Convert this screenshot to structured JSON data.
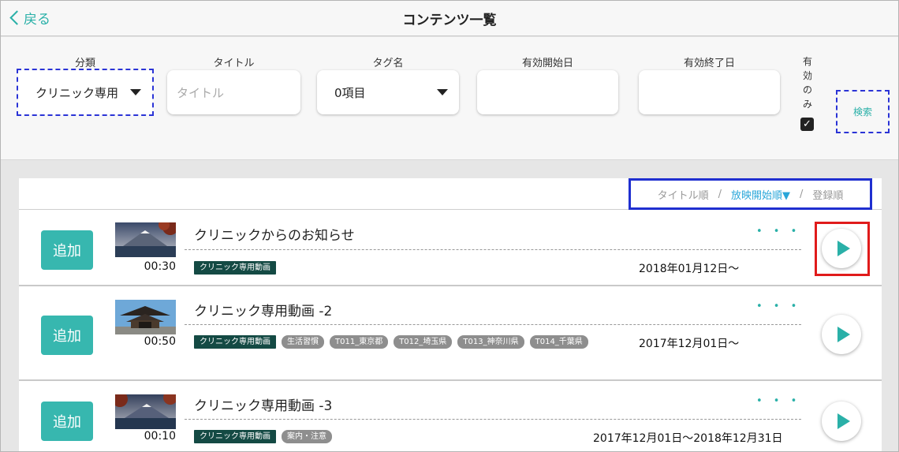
{
  "header": {
    "back_label": "戻る",
    "title": "コンテンツ一覧"
  },
  "filters": {
    "category": {
      "label": "分類",
      "value": "クリニック専用"
    },
    "title": {
      "label": "タイトル",
      "placeholder": "タイトル"
    },
    "tag": {
      "label": "タグ名",
      "value": "0項目"
    },
    "start_date": {
      "label": "有効開始日",
      "value": ""
    },
    "end_date": {
      "label": "有効終了日",
      "value": ""
    },
    "valid_only": {
      "label_chars": [
        "有",
        "効",
        "の",
        "み"
      ],
      "checked": true,
      "check_mark": "✓"
    },
    "search_label": "検索"
  },
  "sort": {
    "title_order": "タイトル順",
    "separator": "/",
    "start_order": "放映開始順▼",
    "register_order": "登録順"
  },
  "items": [
    {
      "add_label": "追加",
      "duration": "00:30",
      "title": "クリニックからのお知らせ",
      "more": "• • •",
      "tags": [
        {
          "text": "クリニック専用動画",
          "style": "primary"
        }
      ],
      "date": "2018年01月12日〜"
    },
    {
      "add_label": "追加",
      "duration": "00:50",
      "title": "クリニック専用動画 -2",
      "more": "• • •",
      "tags": [
        {
          "text": "クリニック専用動画",
          "style": "primary"
        },
        {
          "text": "生活習慣",
          "style": "gray"
        },
        {
          "text": "T011_東京都",
          "style": "gray"
        },
        {
          "text": "T012_埼玉県",
          "style": "gray"
        },
        {
          "text": "T013_神奈川県",
          "style": "gray"
        },
        {
          "text": "T014_千葉県",
          "style": "gray"
        }
      ],
      "date": "2017年12月01日〜"
    },
    {
      "add_label": "追加",
      "duration": "00:10",
      "title": "クリニック専用動画 -3",
      "more": "• • •",
      "tags": [
        {
          "text": "クリニック専用動画",
          "style": "primary"
        },
        {
          "text": "案内・注意",
          "style": "gray"
        }
      ],
      "date": "2017年12月01日〜2018年12月31日"
    }
  ],
  "colors": {
    "accent": "#2ab0a8",
    "add_button": "#37b7af",
    "sort_active": "#29a6d9",
    "annotation_blue": "#1f2fd0",
    "annotation_red": "#e01b1b"
  }
}
